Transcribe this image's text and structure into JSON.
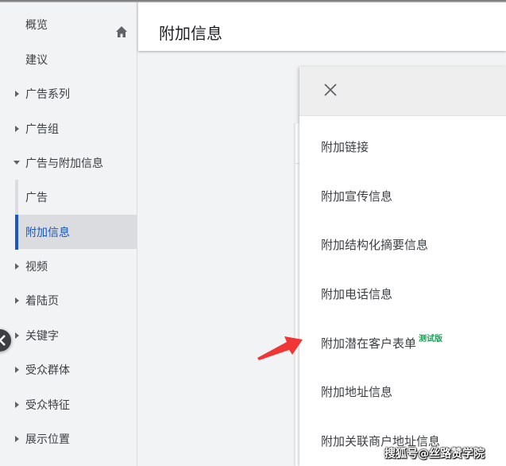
{
  "sidebar": {
    "items": [
      {
        "label": "概览",
        "icon": "home-icon"
      },
      {
        "label": "建议"
      },
      {
        "label": "广告系列",
        "expandable": true
      },
      {
        "label": "广告组",
        "expandable": true
      },
      {
        "label": "广告与附加信息",
        "expandable": true,
        "expanded": true
      },
      {
        "label": "广告",
        "sub": true
      },
      {
        "label": "附加信息",
        "sub": true,
        "active": true
      },
      {
        "label": "视频",
        "expandable": true
      },
      {
        "label": "着陆页",
        "expandable": true
      },
      {
        "label": "关键字",
        "expandable": true
      },
      {
        "label": "受众群体",
        "expandable": true
      },
      {
        "label": "受众特征",
        "expandable": true
      },
      {
        "label": "展示位置",
        "expandable": true
      }
    ],
    "collapse_icon": "chevron-left-icon"
  },
  "header": {
    "title": "附加信息"
  },
  "panel": {
    "close_icon": "close-icon",
    "items": [
      {
        "label": "附加链接"
      },
      {
        "label": "附加宣传信息"
      },
      {
        "label": "附加结构化摘要信息"
      },
      {
        "label": "附加电话信息"
      },
      {
        "label": "附加潜在客户表单",
        "badge": "测试版"
      },
      {
        "label": "附加地址信息"
      },
      {
        "label": "附加关联商户地址信息"
      }
    ]
  },
  "colors": {
    "accent": "#1a56c4",
    "beta": "#1e9e57",
    "annotation_arrow": "#f03535"
  },
  "watermark": "搜狐号@丝路赞学院"
}
